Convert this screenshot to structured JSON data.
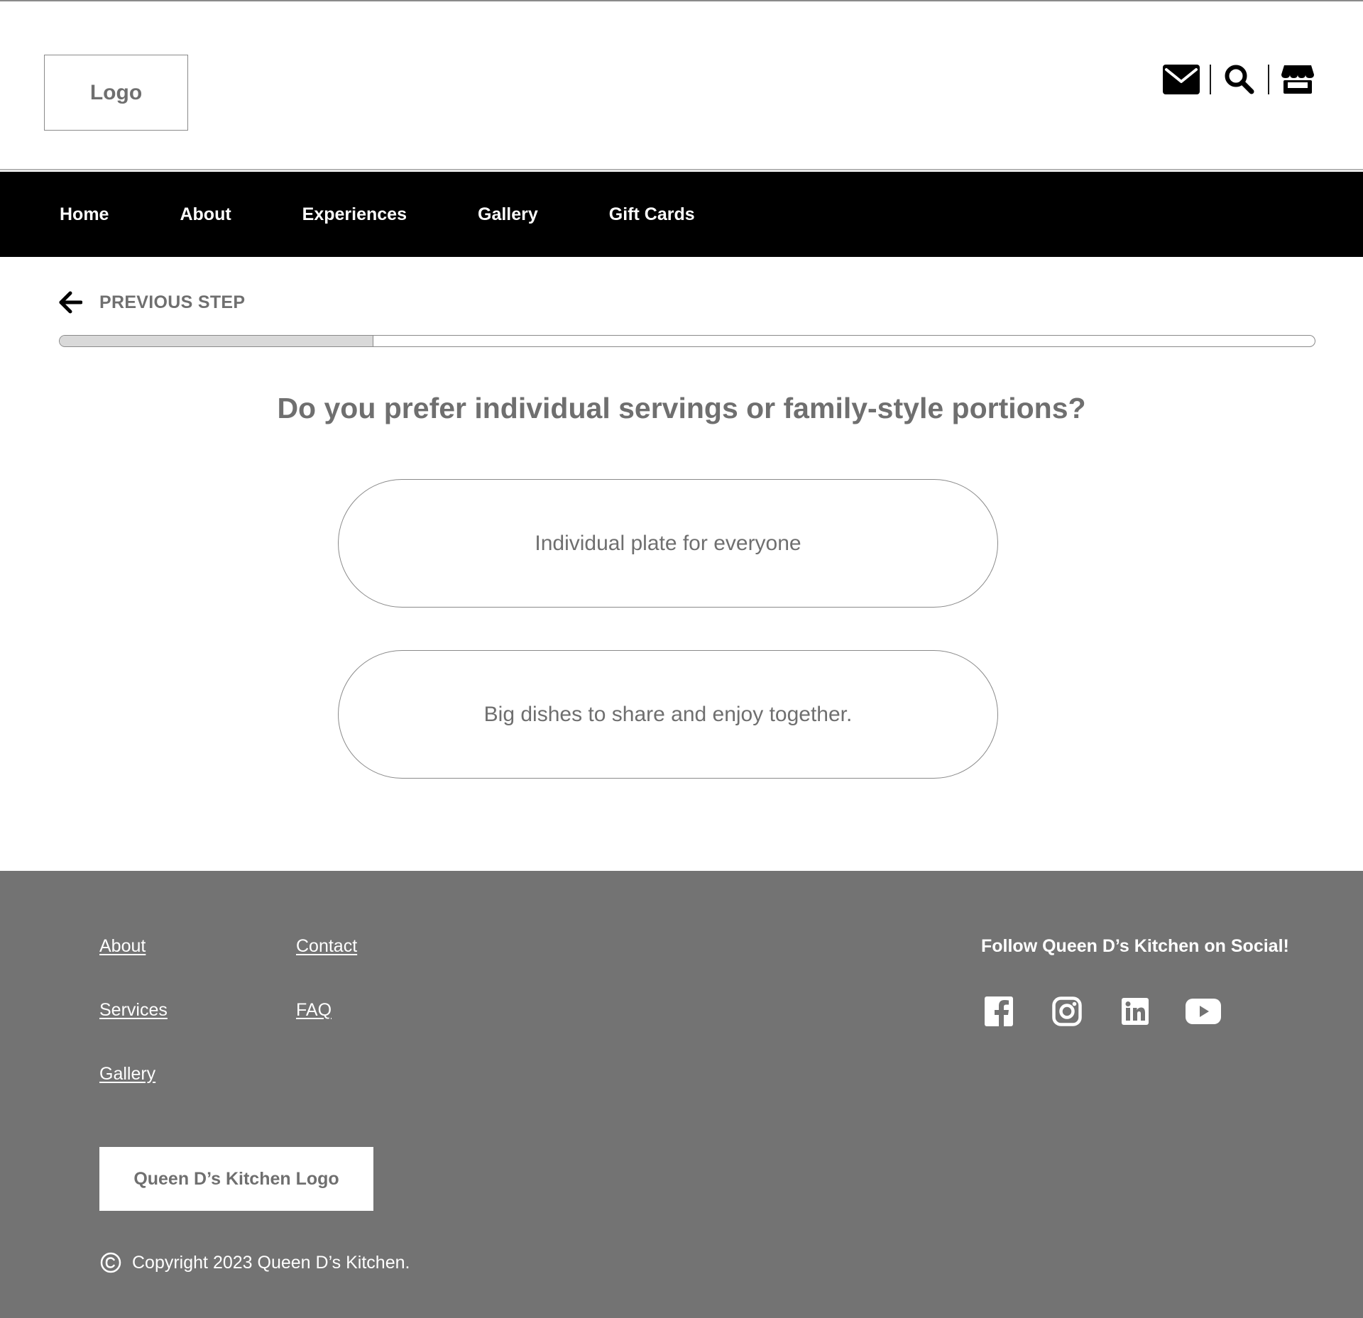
{
  "header": {
    "logo_text": "Logo",
    "icons": [
      "mail-icon",
      "search-icon",
      "store-icon"
    ]
  },
  "nav": {
    "items": [
      {
        "label": "Home"
      },
      {
        "label": "About"
      },
      {
        "label": "Experiences"
      },
      {
        "label": "Gallery"
      },
      {
        "label": "Gift Cards"
      }
    ]
  },
  "quiz": {
    "previous_label": "PREVIOUS STEP",
    "progress": 0.25,
    "question": "Do you prefer individual servings or family-style portions?",
    "options": [
      {
        "label": "Individual plate for everyone"
      },
      {
        "label": "Big dishes to share and enjoy together."
      }
    ]
  },
  "footer": {
    "links": [
      {
        "label": "About"
      },
      {
        "label": "Contact"
      },
      {
        "label": "Services"
      },
      {
        "label": "FAQ"
      },
      {
        "label": "Gallery"
      }
    ],
    "follow_text": "Follow Queen D’s Kitchen on Social!",
    "socials": [
      "facebook-icon",
      "instagram-icon",
      "linkedin-icon",
      "youtube-icon"
    ],
    "logo_text": "Queen D’s Kitchen Logo",
    "copyright": "Copyright 2023 Queen D’s Kitchen."
  },
  "colors": {
    "nav_bg": "#000000",
    "footer_bg": "#737373",
    "text_gray": "#6f6f6f",
    "border_gray": "#8a8a8a",
    "progress_fill": "#d9d9d9"
  }
}
